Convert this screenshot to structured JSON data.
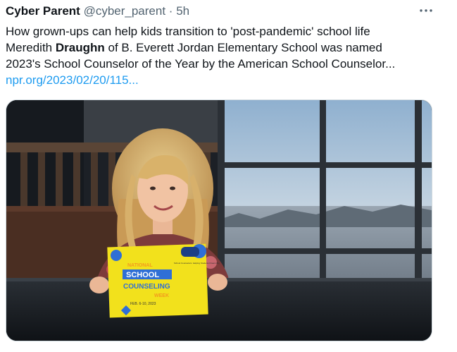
{
  "tweet": {
    "author_name": "Cyber Parent",
    "handle": "@cyber_parent",
    "separator": "·",
    "time": "5h",
    "more_icon": "more-horizontal-icon",
    "line1": "How grown-ups can help kids transition to 'post-pandemic' school life",
    "line2_pre": "Meredith ",
    "line2_bold": "Draughn",
    "line2_post": " of B. Everett Jordan Elementary School was named",
    "line3": "2023's School Counselor of the Year by the American School Counselor...",
    "link_text": "npr.org/2023/02/20/115..."
  },
  "media": {
    "board_line1": "NATIONAL",
    "board_line2": "SCHOOL",
    "board_line3": "COUNSELING",
    "board_line4": "WEEK",
    "board_dates": "FEB. 6-10, 2023",
    "board_side": "School Counselors: Helping Students Dream Big",
    "colors": {
      "board_yellow": "#f2e11c",
      "board_blue": "#2f6fd6",
      "board_orange": "#f39a1e",
      "link": "#1d9bf0"
    }
  }
}
